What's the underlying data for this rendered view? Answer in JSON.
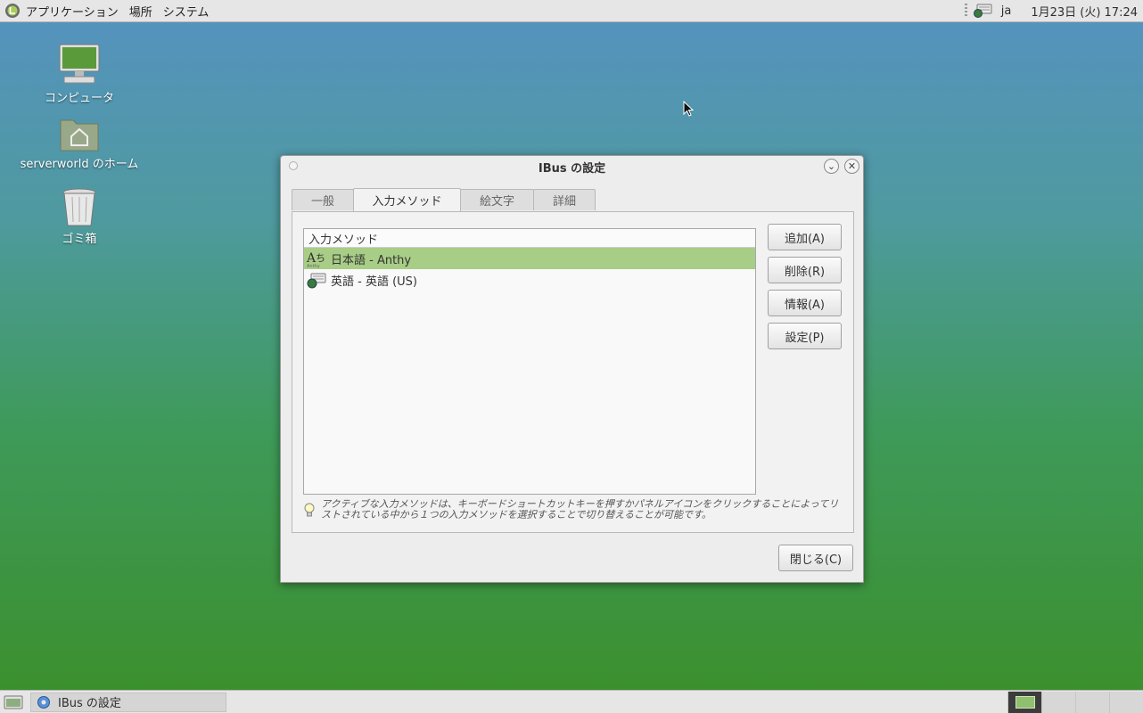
{
  "top_panel": {
    "menus": [
      "アプリケーション",
      "場所",
      "システム"
    ],
    "lang": "ja",
    "clock": "1月23日 (火) 17:24"
  },
  "desktop_icons": [
    {
      "label": "コンピュータ",
      "icon": "computer-icon"
    },
    {
      "label": "serverworld のホーム",
      "icon": "home-folder-icon"
    },
    {
      "label": "ゴミ箱",
      "icon": "trash-icon"
    }
  ],
  "window": {
    "title": "IBus の設定",
    "tabs": [
      "一般",
      "入力メソッド",
      "絵文字",
      "詳細"
    ],
    "active_tab": 1,
    "list": {
      "header": "入力メソッド",
      "rows": [
        {
          "label": "日本語 - Anthy",
          "icon": "anthy-icon",
          "selected": true
        },
        {
          "label": "英語 - 英語 (US)",
          "icon": "keyboard-icon",
          "selected": false
        }
      ]
    },
    "buttons": {
      "add": "追加(A)",
      "remove": "削除(R)",
      "about": "情報(A)",
      "preferences": "設定(P)"
    },
    "hint": "アクティブな入力メソッドは、キーボードショートカットキーを押すかパネルアイコンをクリックすることによってリストされている中から１つの入力メソッドを選択することで切り替えることが可能です。",
    "close": "閉じる(C)"
  },
  "bottom_panel": {
    "task_label": "IBus の設定"
  },
  "colors": {
    "selected_row": "#a8cd86",
    "panel": "#e6e6e6"
  }
}
